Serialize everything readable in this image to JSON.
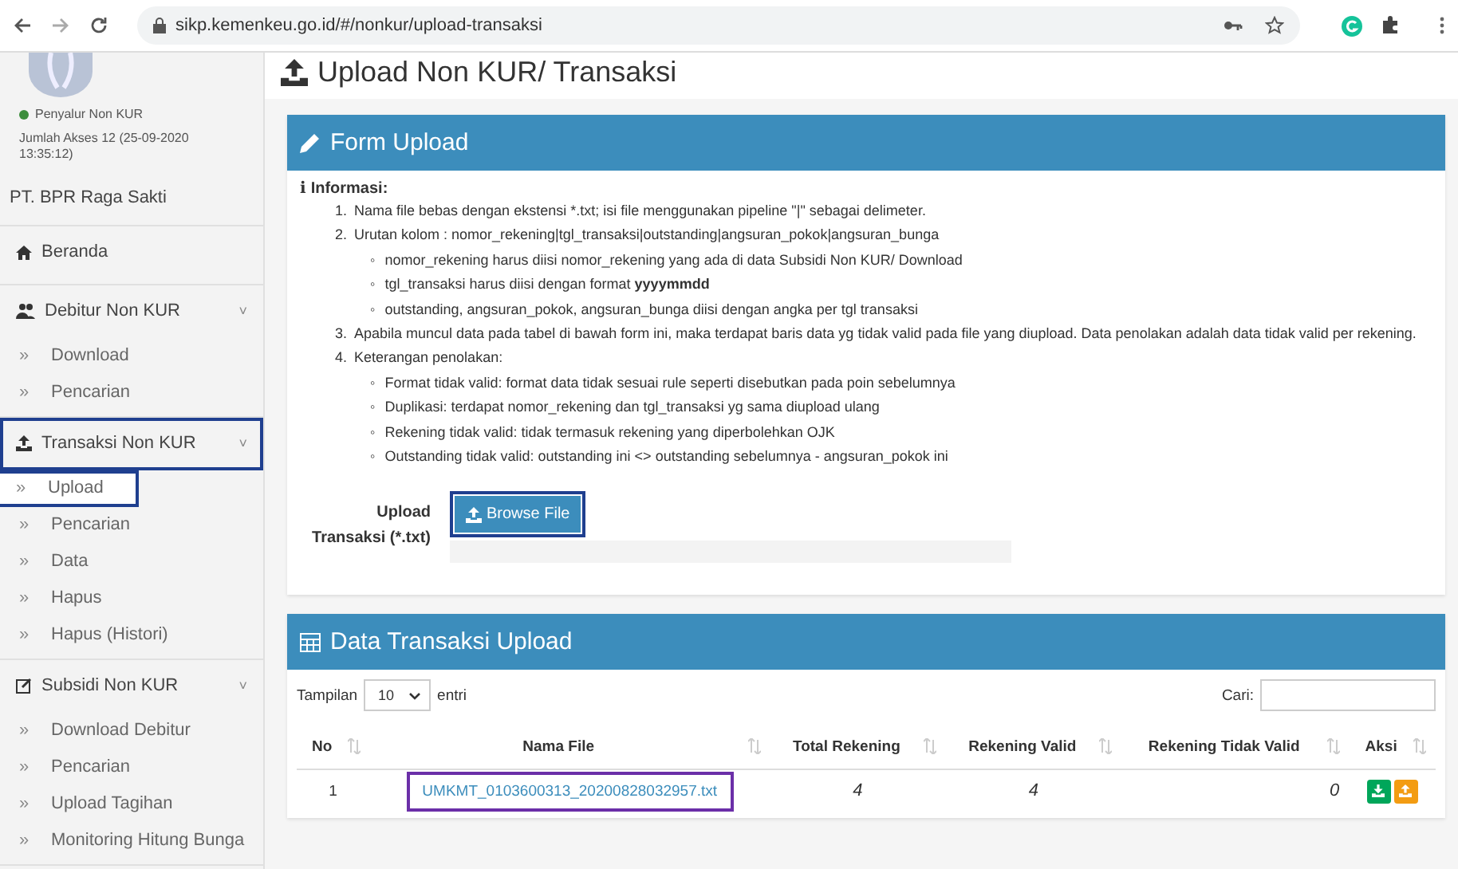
{
  "browser": {
    "url": "sikp.kemenkeu.go.id/#/nonkur/upload-transaksi"
  },
  "sidebar": {
    "status": {
      "label": "Penyalur Non KUR",
      "color": "#3c8d3c"
    },
    "access": "Jumlah Akses 12 (25-09-2020 13:35:12)",
    "company": "PT. BPR Raga Sakti",
    "items": [
      {
        "label": "Beranda",
        "highlighted": false
      },
      {
        "label": "Debitur Non KUR",
        "caret": "˅",
        "highlighted": false,
        "children": [
          {
            "label": "Download",
            "highlighted": false
          },
          {
            "label": "Pencarian",
            "highlighted": false
          }
        ]
      },
      {
        "label": "Transaksi Non KUR",
        "caret": "˅",
        "highlighted": true,
        "children": [
          {
            "label": "Upload",
            "highlighted": true
          },
          {
            "label": "Pencarian",
            "highlighted": false
          },
          {
            "label": "Data",
            "highlighted": false
          },
          {
            "label": "Hapus",
            "highlighted": false
          },
          {
            "label": "Hapus (Histori)",
            "highlighted": false
          }
        ]
      },
      {
        "label": "Subsidi Non KUR",
        "caret": "˅",
        "highlighted": false,
        "children": [
          {
            "label": "Download Debitur",
            "highlighted": false
          },
          {
            "label": "Pencarian",
            "highlighted": false
          },
          {
            "label": "Upload Tagihan",
            "highlighted": false
          },
          {
            "label": "Monitoring Hitung Bunga",
            "highlighted": false
          }
        ]
      }
    ],
    "bullet": "»"
  },
  "page_title": "Upload Non KUR/ Transaksi",
  "form_panel": {
    "title": "Form Upload",
    "info_icon": "i",
    "info_heading": "Informasi:",
    "sub_bullet": "◦",
    "info": [
      {
        "number": "1.",
        "text": "Nama file bebas dengan ekstensi *.txt; isi file menggunakan pipeline \"|\" sebagai delimeter."
      },
      {
        "number": "2.",
        "text": "Urutan kolom : nomor_rekening|tgl_transaksi|outstanding|angsuran_pokok|angsuran_bunga",
        "children": [
          "nomor_rekening harus diisi nomor_rekening yang ada di data Subsidi Non KUR/ Download",
          "tgl_transaksi harus diisi dengan format **yyyymmdd**",
          "outstanding, angsuran_pokok, angsuran_bunga diisi dengan angka per tgl transaksi"
        ]
      },
      {
        "number": "3.",
        "text": "Apabila muncul data pada tabel di bawah form ini, maka terdapat baris data yg tidak valid pada file yang diupload. Data penolakan adalah data tidak valid per rekening."
      },
      {
        "number": "4.",
        "text": "Keterangan penolakan:",
        "children": [
          "Format tidak valid: format data tidak sesuai rule seperti disebutkan pada poin sebelumnya",
          "Duplikasi: terdapat nomor_rekening dan tgl_transaksi yg sama diupload ulang",
          "Rekening tidak valid: tidak termasuk rekening yang diperbolehkan OJK",
          "Outstanding tidak valid: outstanding ini <> outstanding sebelumnya - angsuran_pokok ini"
        ]
      }
    ],
    "upload_label": "Upload Transaksi (*.txt)",
    "browse_button": {
      "label": "Browse File",
      "highlighted": true
    }
  },
  "table_panel": {
    "title": "Data Transaksi Upload",
    "show_label": "Tampilan",
    "page_size": "10",
    "entries_label": "entri",
    "search_label": "Cari:",
    "columns": [
      "No",
      "Nama File",
      "Total Rekening",
      "Rekening Valid",
      "Rekening Tidak Valid",
      "Aksi"
    ],
    "rows": [
      {
        "no": "1",
        "file": "UMKMT_0103600313_20200828032957.txt",
        "file_highlighted": true,
        "total": "4",
        "valid": "4",
        "invalid": "0"
      }
    ]
  }
}
